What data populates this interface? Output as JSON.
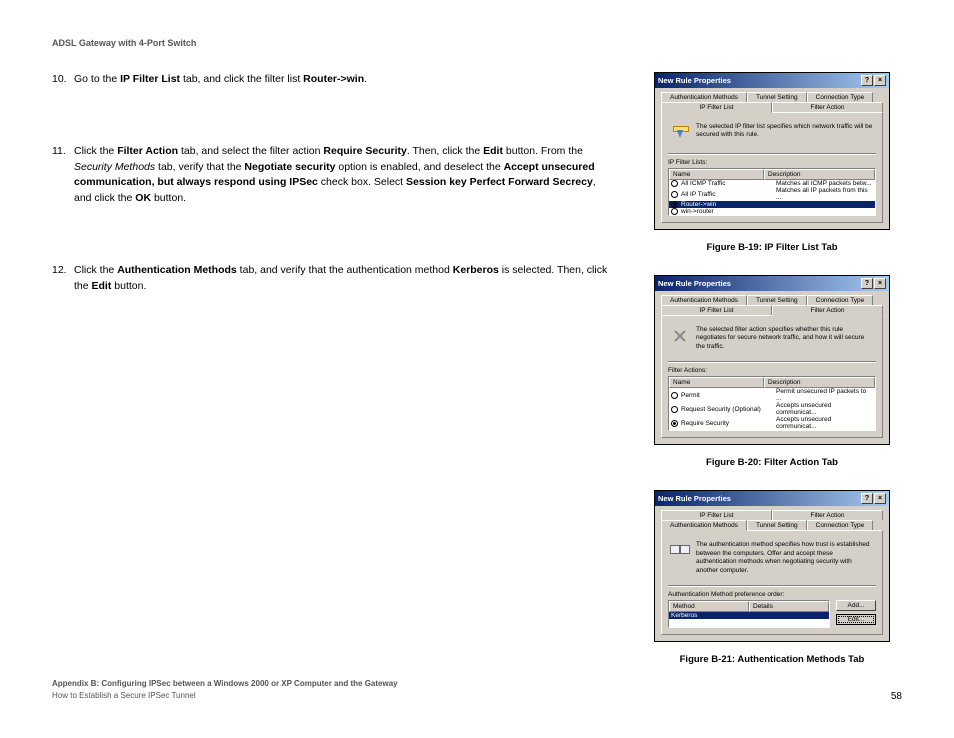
{
  "header": "ADSL Gateway with 4-Port Switch",
  "steps": {
    "s10_num": "10.",
    "s10_a": "Go to the ",
    "s10_b": "IP Filter List",
    "s10_c": " tab, and click the filter list ",
    "s10_d": "Router->win",
    "s10_e": ".",
    "s11_num": "11.",
    "s11_a": "Click the ",
    "s11_b": "Filter Action",
    "s11_c": " tab, and select the filter action ",
    "s11_d": "Require Security",
    "s11_e": ". Then, click the ",
    "s11_f": "Edit",
    "s11_g": " button. From the ",
    "s11_h": "Security Methods",
    "s11_i": " tab, verify that the ",
    "s11_j": "Negotiate security",
    "s11_k": " option is enabled, and deselect the ",
    "s11_l": "Accept unsecured communication, but always respond using IPSec",
    "s11_m": " check box. Select ",
    "s11_n": "Session key Perfect Forward Secrecy",
    "s11_o": ", and click the ",
    "s11_p": "OK",
    "s11_q": " button.",
    "s12_num": "12.",
    "s12_a": "Click the ",
    "s12_b": "Authentication Methods",
    "s12_c": " tab, and verify that the authentication method ",
    "s12_d": "Kerberos",
    "s12_e": " is selected. Then, click the ",
    "s12_f": "Edit",
    "s12_g": " button."
  },
  "figs": {
    "cap19": "Figure B-19: IP Filter List Tab",
    "cap20": "Figure B-20: Filter Action Tab",
    "cap21": "Figure B-21: Authentication Methods Tab"
  },
  "dlg": {
    "title": "New Rule Properties",
    "help": "?",
    "close": "×",
    "tab_auth": "Authentication Methods",
    "tab_tunnel": "Tunnel Setting",
    "tab_conn": "Connection Type",
    "tab_ipfilter": "IP Filter List",
    "tab_faction": "Filter Action",
    "desc1": "The selected IP filter list specifies which network traffic will be secured with this rule.",
    "label1": "IP Filter Lists:",
    "col_name": "Name",
    "col_desc": "Description",
    "r1_n": "All ICMP Traffic",
    "r1_d": "Matches all ICMP packets betw...",
    "r2_n": "All IP Traffic",
    "r2_d": "Matches all IP packets from this ...",
    "r3_n": "Router->win",
    "r3_d": "",
    "r4_n": "win->router",
    "r4_d": "",
    "desc2": "The selected filter action specifies whether this rule negotiates for secure network traffic, and how it will secure the traffic.",
    "label2": "Filter Actions:",
    "fa1_n": "Permit",
    "fa1_d": "Permit unsecured IP packets to ...",
    "fa2_n": "Request Security (Optional)",
    "fa2_d": "Accepts unsecured communicat...",
    "fa3_n": "Require Security",
    "fa3_d": "Accepts unsecured communicat...",
    "desc3": "The authentication method specifies how trust is established between the computers. Offer and accept these authentication methods when negotiating security with another computer.",
    "label3": "Authentication Method preference order:",
    "am_col1": "Method",
    "am_col2": "Details",
    "am_r1": "Kerberos",
    "btn_add": "Add...",
    "btn_edit": "Edit..."
  },
  "footer": {
    "line1": "Appendix B: Configuring IPSec between a Windows 2000 or XP Computer and the Gateway",
    "line2": "How to Establish a Secure IPSec Tunnel",
    "page": "58"
  }
}
